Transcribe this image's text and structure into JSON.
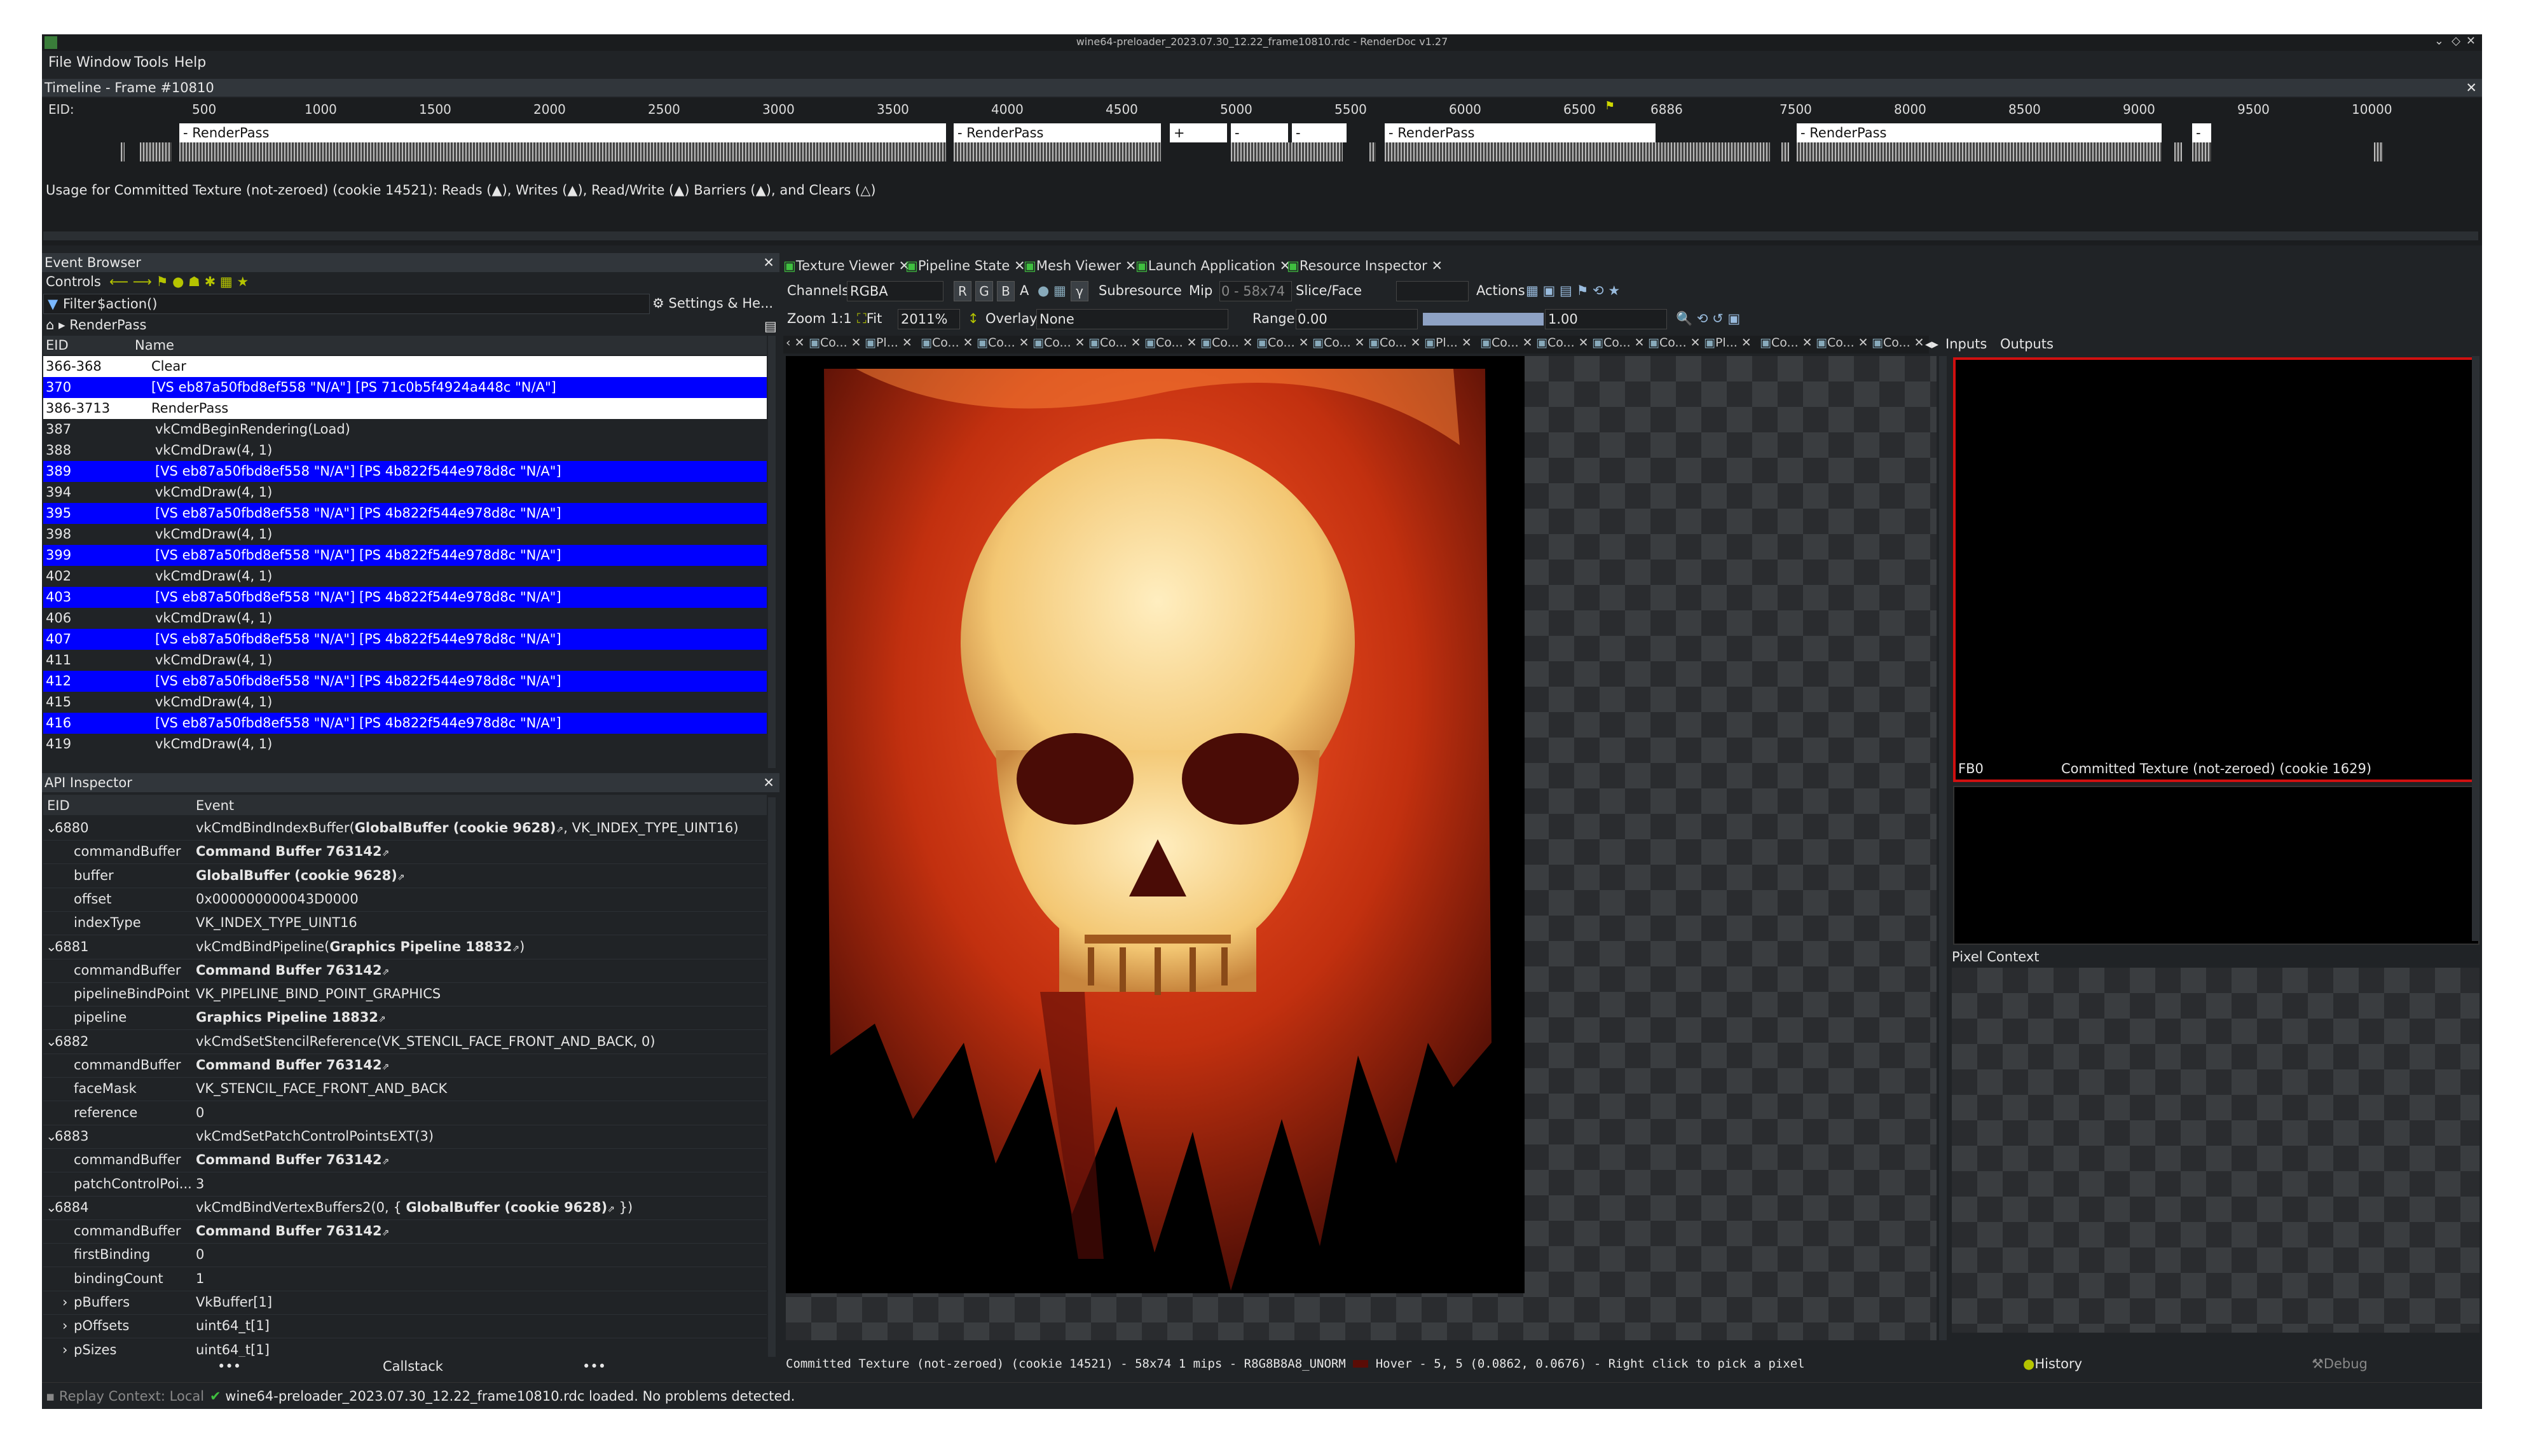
{
  "window": {
    "title": "wine64-preloader_2023.07.30_12.22_frame10810.rdc - RenderDoc v1.27",
    "menu": [
      "File",
      "Window",
      "Tools",
      "Help"
    ]
  },
  "timeline": {
    "title": "Timeline - Frame #10810",
    "eid_label": "EID:",
    "ticks": [
      "500",
      "1000",
      "1500",
      "2000",
      "2500",
      "3000",
      "3500",
      "4000",
      "4500",
      "5000",
      "5500",
      "6000",
      "6500",
      "6886",
      "7500",
      "8000",
      "8500",
      "9000",
      "9500",
      "10000"
    ],
    "passes": [
      "- RenderPass",
      "- RenderPass",
      "+ Rend...",
      "- Rend...",
      "- Rend...",
      "- RenderPass",
      "- RenderPass",
      "-"
    ],
    "usage_text": "Usage for Committed Texture (not-zeroed) (cookie 14521):  Reads (▲), Writes (▲), Read/Write (▲) Barriers (▲), and Clears (△)"
  },
  "event_browser": {
    "title": "Event Browser",
    "controls_label": "Controls",
    "filter": "$action()",
    "filter_label": "Filter",
    "settings_label": "Settings & He...",
    "breadcrumb": "RenderPass",
    "col_eid": "EID",
    "col_name": "Name",
    "rows": [
      {
        "eid": "366-368",
        "name": "Clear",
        "style": "wht",
        "indent": 0
      },
      {
        "eid": "370",
        "name": "[VS eb87a50fbd8ef558 \"N/A\"] [PS 71c0b5f4924a448c \"N/A\"]",
        "style": "sel",
        "indent": 0
      },
      {
        "eid": "386-3713",
        "name": "RenderPass",
        "style": "wht",
        "indent": 0
      },
      {
        "eid": "387",
        "name": "vkCmdBeginRendering(Load)",
        "style": "drk",
        "indent": 1
      },
      {
        "eid": "388",
        "name": "vkCmdDraw(4, 1)",
        "style": "drk",
        "indent": 1
      },
      {
        "eid": "389",
        "name": "[VS eb87a50fbd8ef558 \"N/A\"] [PS 4b822f544e978d8c \"N/A\"]",
        "style": "sel",
        "indent": 1
      },
      {
        "eid": "394",
        "name": "vkCmdDraw(4, 1)",
        "style": "drk",
        "indent": 1
      },
      {
        "eid": "395",
        "name": "[VS eb87a50fbd8ef558 \"N/A\"] [PS 4b822f544e978d8c \"N/A\"]",
        "style": "sel",
        "indent": 1
      },
      {
        "eid": "398",
        "name": "vkCmdDraw(4, 1)",
        "style": "drk",
        "indent": 1
      },
      {
        "eid": "399",
        "name": "[VS eb87a50fbd8ef558 \"N/A\"] [PS 4b822f544e978d8c \"N/A\"]",
        "style": "sel",
        "indent": 1
      },
      {
        "eid": "402",
        "name": "vkCmdDraw(4, 1)",
        "style": "drk",
        "indent": 1
      },
      {
        "eid": "403",
        "name": "[VS eb87a50fbd8ef558 \"N/A\"] [PS 4b822f544e978d8c \"N/A\"]",
        "style": "sel",
        "indent": 1
      },
      {
        "eid": "406",
        "name": "vkCmdDraw(4, 1)",
        "style": "drk",
        "indent": 1
      },
      {
        "eid": "407",
        "name": "[VS eb87a50fbd8ef558 \"N/A\"] [PS 4b822f544e978d8c \"N/A\"]",
        "style": "sel",
        "indent": 1
      },
      {
        "eid": "411",
        "name": "vkCmdDraw(4, 1)",
        "style": "drk",
        "indent": 1
      },
      {
        "eid": "412",
        "name": "[VS eb87a50fbd8ef558 \"N/A\"] [PS 4b822f544e978d8c \"N/A\"]",
        "style": "sel",
        "indent": 1
      },
      {
        "eid": "415",
        "name": "vkCmdDraw(4, 1)",
        "style": "drk",
        "indent": 1
      },
      {
        "eid": "416",
        "name": "[VS eb87a50fbd8ef558 \"N/A\"] [PS 4b822f544e978d8c \"N/A\"]",
        "style": "sel",
        "indent": 1
      },
      {
        "eid": "419",
        "name": "vkCmdDraw(4, 1)",
        "style": "drk",
        "indent": 1
      }
    ]
  },
  "api_inspector": {
    "title": "API Inspector",
    "col_eid": "EID",
    "col_event": "Event",
    "rows": [
      {
        "type": "group",
        "eid": "6880",
        "pre": "vkCmdBindIndexBuffer(",
        "bold": "GlobalBuffer (cookie 9628)",
        "post": ", VK_INDEX_TYPE_UINT16)"
      },
      {
        "type": "param",
        "key": "commandBuffer",
        "bold": "Command Buffer 763142",
        "val": ""
      },
      {
        "type": "param",
        "key": "buffer",
        "bold": "GlobalBuffer (cookie 9628)",
        "val": ""
      },
      {
        "type": "param",
        "key": "offset",
        "bold": "",
        "val": "0x000000000043D0000"
      },
      {
        "type": "param",
        "key": "indexType",
        "bold": "",
        "val": "VK_INDEX_TYPE_UINT16"
      },
      {
        "type": "group",
        "eid": "6881",
        "pre": "vkCmdBindPipeline(",
        "bold": "Graphics Pipeline 18832",
        "post": ")"
      },
      {
        "type": "param",
        "key": "commandBuffer",
        "bold": "Command Buffer 763142",
        "val": ""
      },
      {
        "type": "param",
        "key": "pipelineBindPoint",
        "bold": "",
        "val": "VK_PIPELINE_BIND_POINT_GRAPHICS"
      },
      {
        "type": "param",
        "key": "pipeline",
        "bold": "Graphics Pipeline 18832",
        "val": ""
      },
      {
        "type": "group",
        "eid": "6882",
        "pre": "vkCmdSetStencilReference(VK_STENCIL_FACE_FRONT_AND_BACK, 0)",
        "bold": "",
        "post": ""
      },
      {
        "type": "param",
        "key": "commandBuffer",
        "bold": "Command Buffer 763142",
        "val": ""
      },
      {
        "type": "param",
        "key": "faceMask",
        "bold": "",
        "val": "VK_STENCIL_FACE_FRONT_AND_BACK"
      },
      {
        "type": "param",
        "key": "reference",
        "bold": "",
        "val": "0"
      },
      {
        "type": "group",
        "eid": "6883",
        "pre": "vkCmdSetPatchControlPointsEXT(3)",
        "bold": "",
        "post": ""
      },
      {
        "type": "param",
        "key": "commandBuffer",
        "bold": "Command Buffer 763142",
        "val": ""
      },
      {
        "type": "param",
        "key": "patchControlPoi...",
        "bold": "",
        "val": "3"
      },
      {
        "type": "group",
        "eid": "6884",
        "pre": "vkCmdBindVertexBuffers2(0, { ",
        "bold": "GlobalBuffer (cookie 9628)",
        "post": " })"
      },
      {
        "type": "param",
        "key": "commandBuffer",
        "bold": "Command Buffer 763142",
        "val": ""
      },
      {
        "type": "param",
        "key": "firstBinding",
        "bold": "",
        "val": "0"
      },
      {
        "type": "param",
        "key": "bindingCount",
        "bold": "",
        "val": "1"
      },
      {
        "type": "expand",
        "key": "pBuffers",
        "bold": "",
        "val": "VkBuffer[1]"
      },
      {
        "type": "expand",
        "key": "pOffsets",
        "bold": "",
        "val": "uint64_t[1]"
      },
      {
        "type": "expand",
        "key": "pSizes",
        "bold": "",
        "val": "uint64_t[1]"
      }
    ],
    "bottom_left": "•••",
    "callstack": "Callstack",
    "bottom_right": "•••"
  },
  "tabs": [
    "Texture Viewer",
    "Pipeline State",
    "Mesh Viewer",
    "Launch Application",
    "Resource Inspector"
  ],
  "texture_viewer": {
    "channels_label": "Channels",
    "channels_value": "RGBA",
    "channel_buttons": [
      "R",
      "G",
      "B",
      "A"
    ],
    "gamma_button": "γ",
    "subresource_label": "Subresource",
    "mip_label": "Mip",
    "mip_value": "0 - 58x74",
    "slice_label": "Slice/Face",
    "actions_label": "Actions",
    "zoom_label": "Zoom",
    "zoom_1to1": "1:1",
    "fit_label": "Fit",
    "zoom_value": "2011%",
    "overlay_label": "Overlay",
    "overlay_value": "None",
    "range_label": "Range",
    "range_min": "0.00",
    "range_max": "1.00",
    "mini_tabs": [
      "Co...",
      "Pl...",
      "Co...",
      "Co...",
      "Co...",
      "Co...",
      "Co...",
      "Co...",
      "Co...",
      "Co...",
      "Co...",
      "Pl...",
      "Co...",
      "Co...",
      "Co...",
      "Co...",
      "Pl...",
      "Co...",
      "Co...",
      "Co..."
    ],
    "inputs_tab": "Inputs",
    "outputs_tab": "Outputs",
    "thumb_label_left": "FB0",
    "thumb_label": "Committed Texture (not-zeroed) (cookie 1629)",
    "pixel_context": "Pixel Context",
    "status": "Committed Texture (not-zeroed) (cookie 14521) - 58x74 1 mips - R8G8B8A8_UNORM",
    "hover": "Hover -      5,     5 (0.0862, 0.0676)  - Right click to pick a pixel",
    "history_label": "History",
    "debug_label": "Debug"
  },
  "statusbar": {
    "replay": "Replay Context: Local",
    "message": "wine64-preloader_2023.07.30_12.22_frame10810.rdc loaded. No problems detected."
  }
}
